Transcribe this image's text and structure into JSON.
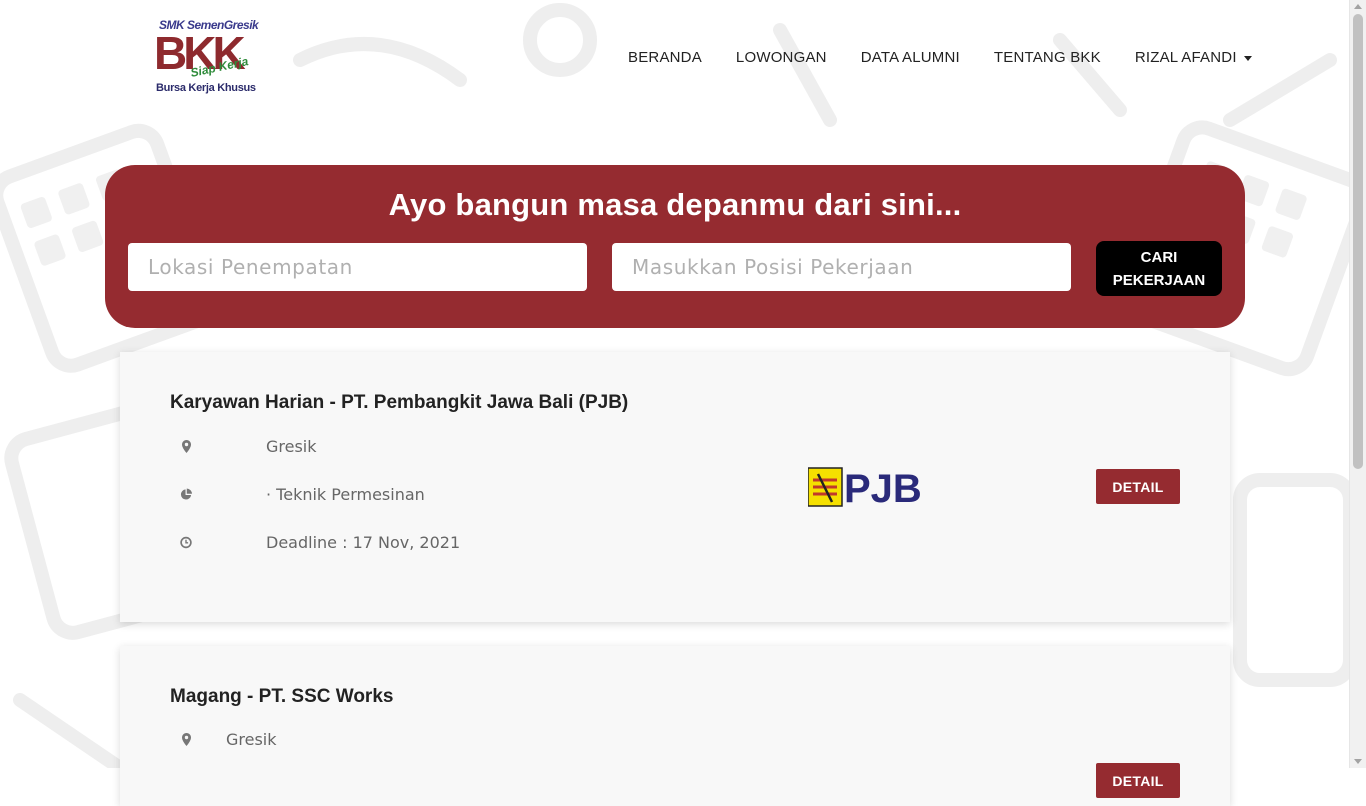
{
  "brand": {
    "line1": "SMK SemenGresik",
    "line2": "BKK",
    "line3": "Siap Kerja",
    "line4": "Bursa Kerja Khusus"
  },
  "nav": {
    "items": [
      "BERANDA",
      "LOWONGAN",
      "DATA ALUMNI",
      "TENTANG BKK"
    ],
    "user": "RIZAL AFANDI"
  },
  "hero": {
    "heading": "Ayo bangun masa depanmu dari sini...",
    "location_placeholder": "Lokasi Penempatan",
    "position_placeholder": "Masukkan Posisi Pekerjaan",
    "search_button": "CARI PEKERJAAN"
  },
  "jobs": [
    {
      "title": "Karyawan Harian - PT. Pembangkit Jawa Bali (PJB)",
      "location": "Gresik",
      "field": "· Teknik Permesinan",
      "deadline": "Deadline : 17 Nov, 2021",
      "logo_text": "PJB",
      "detail_button": "DETAIL"
    },
    {
      "title": "Magang - PT. SSC Works",
      "location": "Gresik",
      "detail_button": "DETAIL"
    }
  ],
  "icons": {
    "location": "map-marker-icon",
    "field": "pie-chart-icon",
    "deadline": "clock-icon",
    "dropdown": "caret-down-icon"
  },
  "colors": {
    "primary": "#952b30",
    "search_button": "#000000",
    "card_bg": "#f8f8f8"
  }
}
